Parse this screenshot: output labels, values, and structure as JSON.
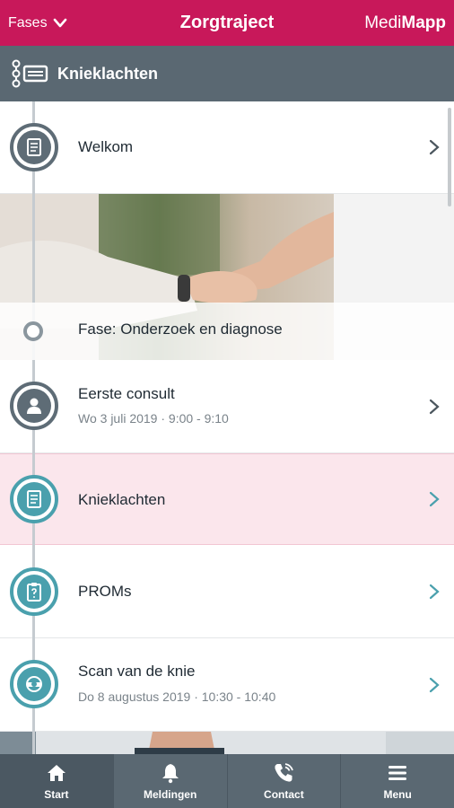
{
  "topbar": {
    "phases_label": "Fases",
    "title": "Zorgtraject",
    "brand_prefix": "Medi",
    "brand_suffix": "Mapp"
  },
  "subheader": {
    "label": "Knieklachten"
  },
  "timeline": {
    "welcome": {
      "title": "Welkom"
    },
    "phase": {
      "label": "Fase: Onderzoek en diagnose"
    },
    "items": [
      {
        "title": "Eerste consult",
        "subtitle": "Wo 3 juli 2019 · 9:00 - 9:10",
        "icon": "person-icon"
      },
      {
        "title": "Knieklachten",
        "icon": "document-icon"
      },
      {
        "title": "PROMs",
        "icon": "clipboard-question-icon"
      },
      {
        "title": "Scan van de knie",
        "subtitle": "Do 8 augustus 2019 · 10:30 - 10:40",
        "icon": "scan-icon"
      }
    ]
  },
  "bottomnav": {
    "tabs": [
      {
        "label": "Start",
        "icon": "home-icon"
      },
      {
        "label": "Meldingen",
        "icon": "bell-icon"
      },
      {
        "label": "Contact",
        "icon": "phone-icon"
      },
      {
        "label": "Menu",
        "icon": "hamburger-icon"
      }
    ]
  },
  "colors": {
    "brand": "#c8185a",
    "header_gray": "#5a6872",
    "node_gray": "#5e6c76",
    "node_teal": "#4aa0ad",
    "highlight": "#fbe6ec"
  }
}
